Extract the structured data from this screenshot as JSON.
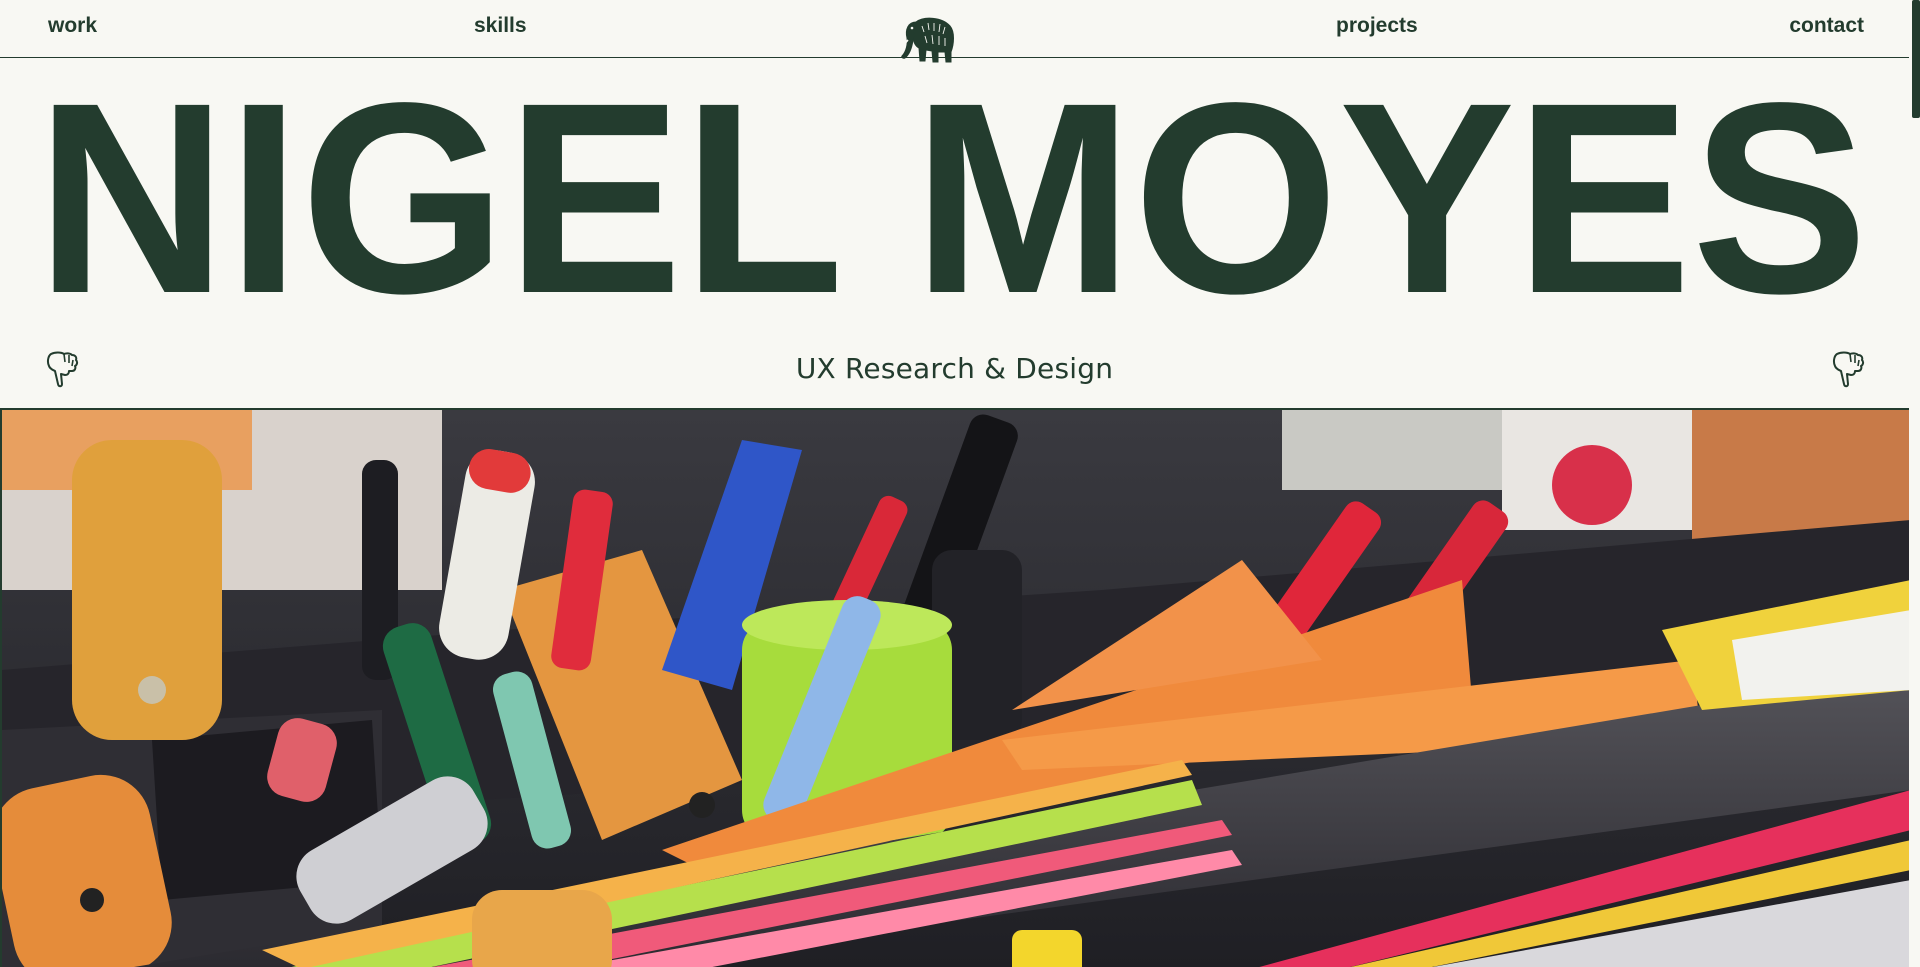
{
  "nav": {
    "items": [
      {
        "label": "work"
      },
      {
        "label": "skills"
      },
      {
        "label": "projects"
      },
      {
        "label": "contact"
      }
    ],
    "logo_icon": "mammoth-icon"
  },
  "hero": {
    "title": "NIGEL MOYES",
    "subtitle": "UX Research & Design",
    "left_icon": "pointing-hand-down-icon",
    "right_icon": "pointing-hand-down-icon"
  },
  "image": {
    "subject_icon": "stationery-photo"
  },
  "colors": {
    "brand": "#233c2e",
    "background": "#f8f8f3"
  }
}
